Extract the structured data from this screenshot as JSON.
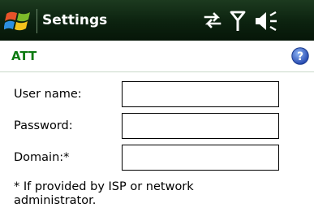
{
  "titlebar": {
    "title": "Settings",
    "start_icon": "windows-flag-icon",
    "status_icons": [
      "data-sync-icon",
      "signal-antenna-icon",
      "speaker-icon"
    ]
  },
  "subheader": {
    "title": "ATT",
    "help_icon": "help-icon"
  },
  "form": {
    "fields": [
      {
        "label": "User name:",
        "value": ""
      },
      {
        "label": "Password:",
        "value": ""
      },
      {
        "label": "Domain:*",
        "value": ""
      }
    ]
  },
  "note": "* If provided by ISP or network administrator.",
  "colors": {
    "titlebar_bg": "#0c220f",
    "section_title": "#0c7a10",
    "help_button": "#2f5fc8"
  }
}
